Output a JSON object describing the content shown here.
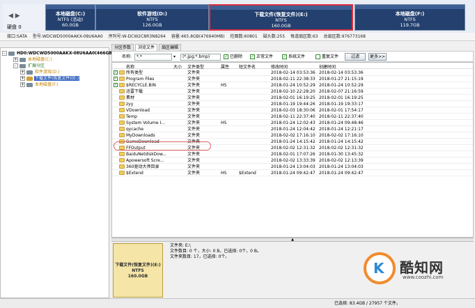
{
  "disk_nav": {
    "label": "硬盘 0"
  },
  "partitions": [
    {
      "name": "本地磁盘(C:)",
      "fs": "NTFS (活动)",
      "size": "60.0GB"
    },
    {
      "name": "软件游戏(D:)",
      "fs": "NTFS",
      "size": "126.0GB"
    },
    {
      "name": "下载文件(恢复文件)(E:)",
      "fs": "NTFS",
      "size": "160.0GB"
    },
    {
      "name": "本地磁盘(F:)",
      "fs": "NTFS",
      "size": "119.7GB"
    }
  ],
  "info_bar": [
    "接口:SATA",
    "型号:WDCWD5000AAKX-08U6AA0",
    "序列号:W-DCW2C8R3N8264",
    "容量:465.8GB(476940MB)",
    "柱面数:60801",
    "磁头数:255",
    "每道扇区数:63",
    "总扇区数:976773168"
  ],
  "tree": [
    {
      "label": "HD0:WDCWD5000AAKX-08U6AA0(466GB)",
      "depth": 0,
      "sign": "-"
    },
    {
      "label": "本地磁盘(C:)",
      "depth": 1,
      "sign": "+"
    },
    {
      "label": "扩展分区",
      "depth": 1,
      "sign": "-"
    },
    {
      "label": "软件游戏(D:)",
      "depth": 2,
      "sign": "+"
    },
    {
      "label": "下载文件(恢复文件)(E:)",
      "depth": 2,
      "sign": "+"
    },
    {
      "label": "本地磁盘(F:)",
      "depth": 2,
      "sign": "+"
    }
  ],
  "tabs": [
    "分区参数",
    "浏览文件",
    "扇区编辑"
  ],
  "filter": {
    "name_label": "名称:",
    "name_value": "*.*",
    "ext_value": "(*.jpg;*.bmp)",
    "checks": [
      "已删除",
      "正常文件",
      "系统文件",
      "重复文件"
    ],
    "btn_filter": "过滤",
    "btn_more": "更多>>"
  },
  "columns": [
    "名称",
    "大小",
    "文件类型",
    "属性",
    "短文件名",
    "修改时间",
    "创建时间"
  ],
  "files": [
    {
      "name": "所有类型",
      "size": "",
      "type": "文件夹",
      "attr": "",
      "short": "",
      "modified": "2018-02-14 03:53:36",
      "created": "2018-02-14 03:53:36",
      "checked": true
    },
    {
      "name": "Program Files",
      "size": "",
      "type": "文件夹",
      "attr": "",
      "short": "",
      "modified": "2018-02-11 22:38:33",
      "created": "2018-01-27 21:15:19",
      "checked": true
    },
    {
      "name": "$RECYCLE.BIN",
      "size": "",
      "type": "文件夹",
      "attr": "HS",
      "short": "",
      "modified": "2018-01-24 10:52:29",
      "created": "2018-01-24 10:52:29",
      "checked": true
    },
    {
      "name": "迅雷下载",
      "size": "",
      "type": "文件夹",
      "attr": "",
      "short": "",
      "modified": "2018-02-10 22:28:20",
      "created": "2018-02-07 21:16:59",
      "checked": false
    },
    {
      "name": "素材",
      "size": "",
      "type": "文件夹",
      "attr": "",
      "short": "",
      "modified": "2018-02-01 16:19:25",
      "created": "2018-02-01 16:19:25",
      "checked": false
    },
    {
      "name": "zyy",
      "size": "",
      "type": "文件夹",
      "attr": "",
      "short": "",
      "modified": "2018-01-19 19:44:26",
      "created": "2018-01-19 19:33:17",
      "checked": false
    },
    {
      "name": "VDownload",
      "size": "",
      "type": "文件夹",
      "attr": "",
      "short": "",
      "modified": "2018-02-03 18:30:06",
      "created": "2018-02-01 17:54:17",
      "checked": false
    },
    {
      "name": "Temp",
      "size": "",
      "type": "文件夹",
      "attr": "",
      "short": "",
      "modified": "2018-02-11 22:37:40",
      "created": "2018-02-11 22:37:40",
      "checked": false
    },
    {
      "name": "System Volume I...",
      "size": "",
      "type": "文件夹",
      "attr": "HS",
      "short": "",
      "modified": "2018-01-24 12:02:43",
      "created": "2018-01-24 09:48:46",
      "checked": false
    },
    {
      "name": "qycache",
      "size": "",
      "type": "文件夹",
      "attr": "",
      "short": "",
      "modified": "2018-01-24 12:04:42",
      "created": "2018-01-24 12:21:17",
      "checked": false
    },
    {
      "name": "MyDownloads",
      "size": "",
      "type": "文件夹",
      "attr": "",
      "short": "",
      "modified": "2018-02-02 17:16:10",
      "created": "2018-02-02 17:16:10",
      "checked": false
    },
    {
      "name": "GameDownload",
      "size": "",
      "type": "文件夹",
      "attr": "",
      "short": "",
      "modified": "2018-01-24 14:15:42",
      "created": "2018-01-24 14:15:42",
      "checked": false
    },
    {
      "name": "FFOutput",
      "size": "",
      "type": "文件夹",
      "attr": "",
      "short": "",
      "modified": "2018-02-02 12:31:32",
      "created": "2018-02-02 12:31:32",
      "checked": false
    },
    {
      "name": "BaiduNetdiskDow...",
      "size": "",
      "type": "文件夹",
      "attr": "",
      "short": "",
      "modified": "2018-02-01 17:07:26",
      "created": "2018-01-30 13:45:32",
      "checked": false
    },
    {
      "name": "Apowersoft Scre...",
      "size": "",
      "type": "文件夹",
      "attr": "",
      "short": "",
      "modified": "2018-02-02 13:33:39",
      "created": "2018-02-02 12:13:39",
      "checked": false
    },
    {
      "name": "360驱动大师目录",
      "size": "",
      "type": "文件夹",
      "attr": "",
      "short": "",
      "modified": "2018-01-24 13:04:03",
      "created": "2018-01-24 13:04:03",
      "checked": false
    },
    {
      "name": "$Extend",
      "size": "",
      "type": "文件夹",
      "attr": "HS",
      "short": "$Extend",
      "modified": "2018-01-24 09:42:47",
      "created": "2018-01-24 09:42:47",
      "checked": false
    }
  ],
  "preview": {
    "name": "下载文件(恢复文件)(E:)",
    "fs": "NTFS",
    "size": "160.0GB"
  },
  "details": [
    "文件夹: E:\\",
    "文件数目: 0 个，大小: 0 B，已选择: 0个，0 B。",
    "文件夹数目: 17，已选择: 0个。"
  ],
  "watermark": {
    "brand": "酷知网",
    "url": "www.coozhi.com"
  },
  "status": {
    "left": "",
    "right": "已选择: 83.4GB / 27957 个文件。"
  }
}
